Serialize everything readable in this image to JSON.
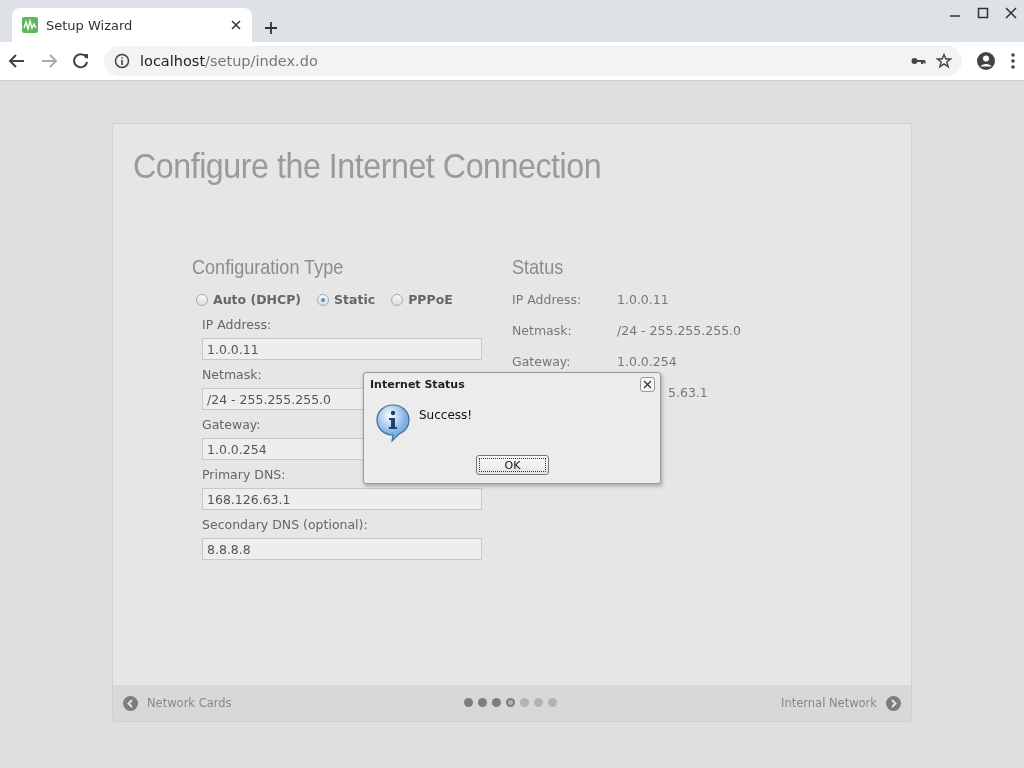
{
  "browser": {
    "tab": {
      "title": "Setup Wizard"
    },
    "address": {
      "host": "localhost",
      "path": "/setup/index.do"
    },
    "forward_disabled": true
  },
  "wizard": {
    "title": "Configure the Internet Connection",
    "config": {
      "heading": "Configuration Type",
      "options": [
        {
          "label": "Auto (DHCP)",
          "selected": false
        },
        {
          "label": "Static",
          "selected": true
        },
        {
          "label": "PPPoE",
          "selected": false
        }
      ],
      "fields": [
        {
          "label": "IP Address:",
          "value": "1.0.0.11"
        },
        {
          "label": "Netmask:",
          "value": "/24 - 255.255.255.0"
        },
        {
          "label": "Gateway:",
          "value": "1.0.0.254"
        },
        {
          "label": "Primary DNS:",
          "value": "168.126.63.1"
        },
        {
          "label": "Secondary DNS (optional):",
          "value": "8.8.8.8"
        }
      ]
    },
    "status": {
      "heading": "Status",
      "rows": [
        {
          "label": "IP Address:",
          "value": "1.0.0.11"
        },
        {
          "label": "Netmask:",
          "value": "/24 - 255.255.255.0"
        },
        {
          "label": "Gateway:",
          "value": "1.0.0.254"
        },
        {
          "value": "5.63.1"
        }
      ]
    },
    "footer": {
      "back": "Network Cards",
      "next": "Internal Network",
      "steps": [
        {
          "completed": true,
          "selected": false
        },
        {
          "completed": true,
          "selected": false
        },
        {
          "completed": true,
          "selected": false
        },
        {
          "completed": false,
          "selected": true
        },
        {
          "completed": false,
          "selected": false
        },
        {
          "completed": false,
          "selected": false
        },
        {
          "completed": false,
          "selected": false
        }
      ]
    }
  },
  "dialog": {
    "title": "Internet Status",
    "message": "Success!",
    "button": "OK"
  }
}
